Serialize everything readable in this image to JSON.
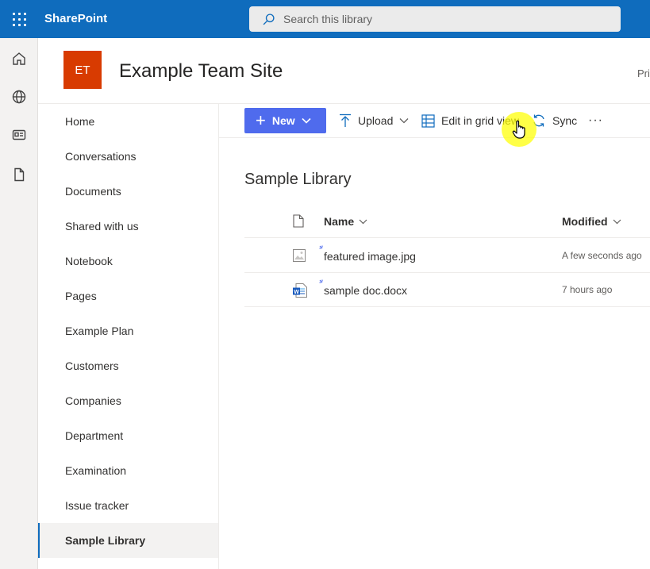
{
  "suitebar": {
    "brand": "SharePoint",
    "search_placeholder": "Search this library",
    "bg_color": "#0f6cbd"
  },
  "rail": {
    "icons": [
      "home-icon",
      "globe-icon",
      "news-icon",
      "document-icon"
    ]
  },
  "site": {
    "logo_initials": "ET",
    "logo_color": "#d83b01",
    "title": "Example Team Site",
    "privacy_truncated": "Pri"
  },
  "nav": {
    "items": [
      {
        "label": "Home"
      },
      {
        "label": "Conversations"
      },
      {
        "label": "Documents"
      },
      {
        "label": "Shared with us"
      },
      {
        "label": "Notebook"
      },
      {
        "label": "Pages"
      },
      {
        "label": "Example Plan"
      },
      {
        "label": "Customers"
      },
      {
        "label": "Companies"
      },
      {
        "label": "Department"
      },
      {
        "label": "Examination"
      },
      {
        "label": "Issue tracker"
      },
      {
        "label": "Sample Library",
        "selected": true
      }
    ]
  },
  "commandbar": {
    "new_label": "New",
    "upload_label": "Upload",
    "grid_label": "Edit in grid view",
    "sync_label": "Sync",
    "more_label": "···",
    "accent": "#4f6bed"
  },
  "library": {
    "title": "Sample Library",
    "columns": {
      "name": "Name",
      "modified": "Modified"
    },
    "files": [
      {
        "name": "featured image.jpg",
        "modified": "A few seconds ago",
        "type": "image"
      },
      {
        "name": "sample doc.docx",
        "modified": "7 hours ago",
        "type": "word"
      }
    ]
  }
}
